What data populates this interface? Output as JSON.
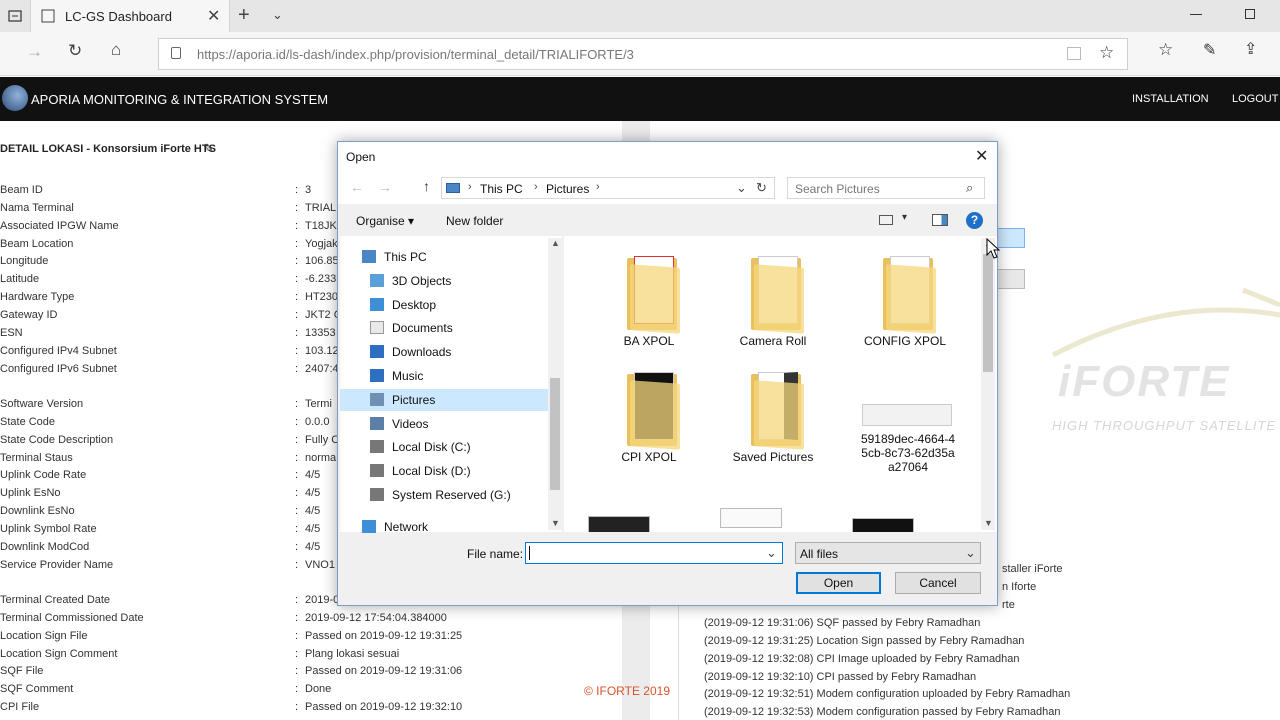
{
  "browser": {
    "tab_title": "LC-GS Dashboard",
    "url": "https://aporia.id/ls-dash/index.php/provision/terminal_detail/TRIALIFORTE/3"
  },
  "app": {
    "title": "APORIA MONITORING & INTEGRATION SYSTEM",
    "nav": [
      "INSTALLATION",
      "LOGOUT"
    ]
  },
  "detail": {
    "heading": "DETAIL LOKASI - Konsorsium iForte HTS",
    "rows": [
      {
        "label": "Beam ID",
        "value": "3"
      },
      {
        "label": "Nama Terminal",
        "value": "TRIALI"
      },
      {
        "label": "Associated IPGW Name",
        "value": "T18JKT"
      },
      {
        "label": "Beam Location",
        "value": "Yogjak"
      },
      {
        "label": "Longitude",
        "value": "106.85"
      },
      {
        "label": "Latitude",
        "value": "-6.233"
      },
      {
        "label": "Hardware Type",
        "value": "HT230"
      },
      {
        "label": "Gateway ID",
        "value": "JKT2 C"
      },
      {
        "label": "ESN",
        "value": "13353"
      },
      {
        "label": "Configured IPv4 Subnet",
        "value": "103.12"
      },
      {
        "label": "Configured IPv6 Subnet",
        "value": "2407:4"
      },
      {
        "label": "Software Version",
        "value": "Termi"
      },
      {
        "label": "State Code",
        "value": "0.0.0"
      },
      {
        "label": "State Code Description",
        "value": "Fully C"
      },
      {
        "label": "Terminal Staus",
        "value": "norma"
      },
      {
        "label": "Uplink Code Rate",
        "value": "4/5"
      },
      {
        "label": "Uplink EsNo",
        "value": "4/5"
      },
      {
        "label": "Downlink EsNo",
        "value": "4/5"
      },
      {
        "label": "Uplink Symbol Rate",
        "value": "4/5"
      },
      {
        "label": "Downlink ModCod",
        "value": "4/5"
      },
      {
        "label": "Service Provider Name",
        "value": "VNO1"
      },
      {
        "label": "Terminal Created Date",
        "value": "2019-0"
      },
      {
        "label": "Terminal Commissioned Date",
        "value": "2019-09-12 17:54:04.384000"
      },
      {
        "label": "Location Sign File",
        "value": "Passed on 2019-09-12 19:31:25"
      },
      {
        "label": "Location Sign Comment",
        "value": "Plang lokasi sesuai"
      },
      {
        "label": "SQF File",
        "value": "Passed on 2019-09-12 19:31:06"
      },
      {
        "label": "SQF Comment",
        "value": "Done"
      },
      {
        "label": "CPI File",
        "value": "Passed on 2019-09-12 19:32:10"
      }
    ]
  },
  "log": {
    "partial": [
      "staller iForte",
      "n Iforte",
      "rte"
    ],
    "entries": [
      "(2019-09-12 19:31:06) SQF passed by Febry Ramadhan",
      "(2019-09-12 19:31:25) Location Sign passed by Febry Ramadhan",
      "(2019-09-12 19:32:08) CPI Image uploaded by Febry Ramadhan",
      "(2019-09-12 19:32:10) CPI passed by Febry Ramadhan",
      "(2019-09-12 19:32:51) Modem configuration uploaded by Febry Ramadhan",
      "(2019-09-12 19:32:53) Modem configuration passed by Febry Ramadhan"
    ]
  },
  "brand": {
    "logo": "iFORTE",
    "tagline": "HIGH THROUGHPUT SATELLITE",
    "footer": "©  IFORTE 2019"
  },
  "dialog": {
    "title": "Open",
    "breadcrumb": [
      "This PC",
      "Pictures"
    ],
    "search_placeholder": "Search Pictures",
    "organise": "Organise ▾",
    "new_folder": "New folder",
    "nav_items": [
      "This PC",
      "3D Objects",
      "Desktop",
      "Documents",
      "Downloads",
      "Music",
      "Pictures",
      "Videos",
      "Local Disk (C:)",
      "Local Disk (D:)",
      "System Reserved (G:)",
      "Network"
    ],
    "files": [
      "BA XPOL",
      "Camera Roll",
      "CONFIG XPOL",
      "CPI XPOL",
      "Saved Pictures",
      "59189dec-4664-4\n5cb-8c73-62d35a\na27064"
    ],
    "file_name_label": "File name:",
    "file_name_value": "",
    "filter": "All files",
    "open_btn": "Open",
    "cancel_btn": "Cancel"
  },
  "colors": {
    "accent": "#0078d7",
    "header_bg": "#111111",
    "selected": "#cce8ff"
  }
}
